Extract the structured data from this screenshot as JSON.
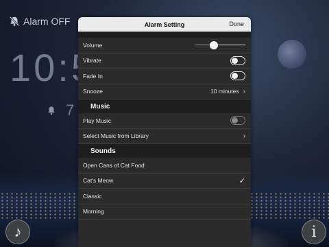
{
  "background": {
    "alarm_status": "Alarm OFF",
    "time_partial": "10:5",
    "alarm_time_partial": "7"
  },
  "sheet": {
    "title": "Alarm Setting",
    "done_label": "Done",
    "settings": {
      "volume": {
        "label": "Volume",
        "value_fraction": 0.38
      },
      "vibrate": {
        "label": "Vibrate",
        "on": false
      },
      "fade_in": {
        "label": "Fade In",
        "on": false
      },
      "snooze": {
        "label": "Snooze",
        "value": "10 minutes"
      }
    },
    "music": {
      "header": "Music",
      "play_music": {
        "label": "Play Music",
        "on": false
      },
      "select_library": {
        "label": "Select Music from Library"
      }
    },
    "sounds": {
      "header": "Sounds",
      "items": [
        {
          "label": "Open Cans of Cat Food",
          "selected": false
        },
        {
          "label": "Cat's Meow",
          "selected": true
        },
        {
          "label": "Classic",
          "selected": false
        },
        {
          "label": "Morning",
          "selected": false
        }
      ]
    }
  },
  "icons": {
    "music_button": "music-note-icon",
    "info_button": "info-icon",
    "alarm_off": "bell-slash-icon",
    "check": "checkmark-icon"
  }
}
